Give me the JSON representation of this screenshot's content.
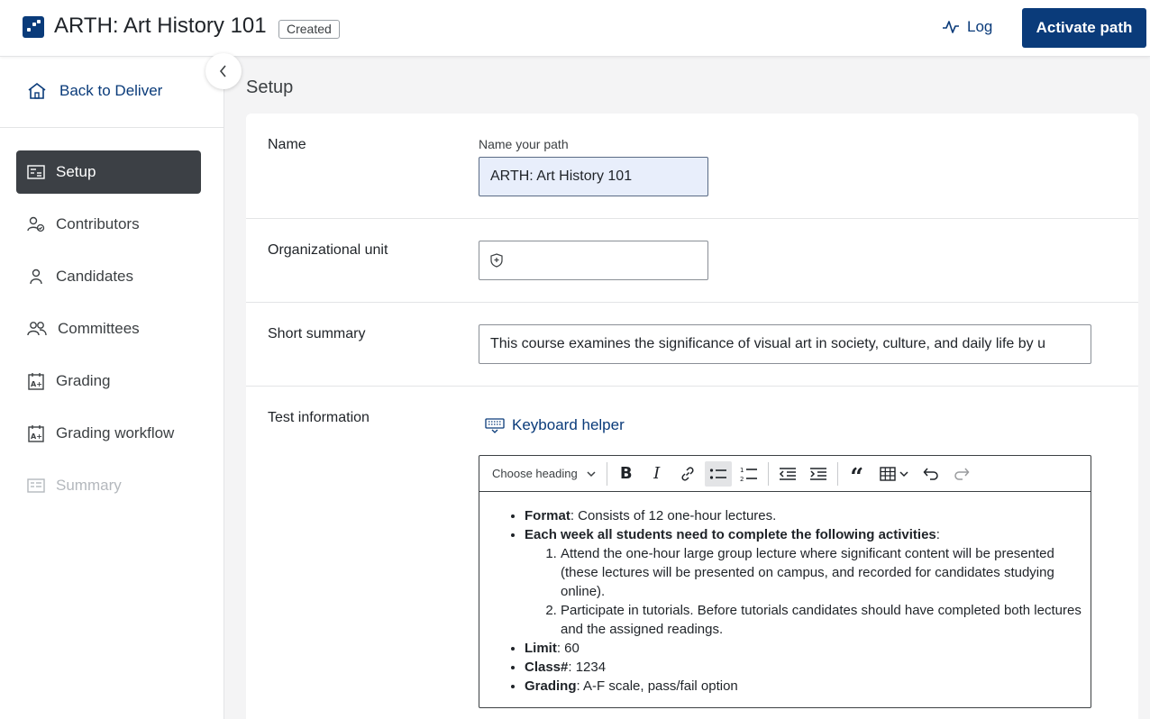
{
  "header": {
    "title": "ARTH: Art History 101",
    "status_badge": "Created",
    "log_label": "Log",
    "activate_label": "Activate path",
    "brand_color": "#0a3b7a"
  },
  "sidebar": {
    "back_label": "Back to Deliver",
    "items": [
      {
        "label": "Setup",
        "icon": "setup-icon",
        "state": "active"
      },
      {
        "label": "Contributors",
        "icon": "contributors-icon",
        "state": "normal"
      },
      {
        "label": "Candidates",
        "icon": "person-icon",
        "state": "normal"
      },
      {
        "label": "Committees",
        "icon": "group-icon",
        "state": "normal"
      },
      {
        "label": "Grading",
        "icon": "grading-icon",
        "state": "normal"
      },
      {
        "label": "Grading workflow",
        "icon": "grading-workflow-icon",
        "state": "normal"
      },
      {
        "label": "Summary",
        "icon": "summary-icon",
        "state": "disabled"
      }
    ]
  },
  "main": {
    "heading": "Setup",
    "name": {
      "label": "Name",
      "field_label": "Name your path",
      "value": "ARTH: Art History 101"
    },
    "org_unit": {
      "label": "Organizational unit",
      "value": ""
    },
    "short_summary": {
      "label": "Short summary",
      "value": "This course examines the significance of visual art in society, culture, and daily life by u"
    },
    "test_info": {
      "label": "Test information",
      "keyboard_helper": "Keyboard helper",
      "heading_select": "Choose heading",
      "content": {
        "format_label": "Format",
        "format_text": ": Consists of 12 one-hour lectures.",
        "weekly_label": "Each week all students need to complete the following activities",
        "weekly_suffix": ":",
        "activity_1": "Attend the one-hour large group lecture where significant content will be presented (these lectures will be presented on campus, and recorded for candidates studying online).",
        "activity_2": "Participate in tutorials. Before tutorials candidates should have completed both lectures and the assigned readings.",
        "limit_label": "Limit",
        "limit_text": ": 60",
        "class_label": "Class#",
        "class_text": ": 1234",
        "grading_label": "Grading",
        "grading_text": ": A-F scale, pass/fail option"
      }
    }
  }
}
